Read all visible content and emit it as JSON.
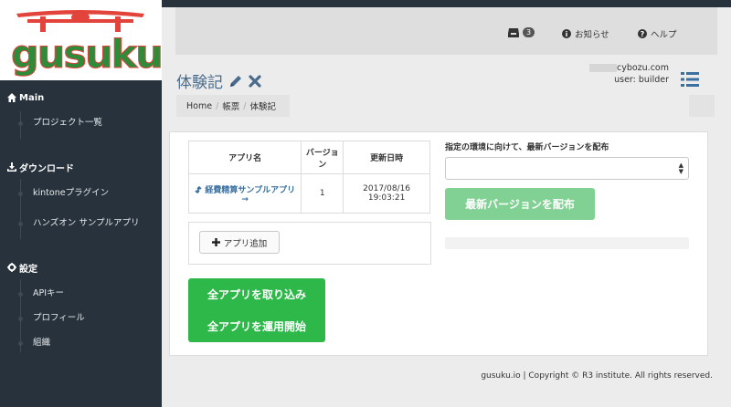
{
  "brand": {
    "logo_text": "gusuku",
    "logo_color": "#2e8b3a",
    "accent_red": "#e2443c"
  },
  "sidebar": {
    "sections": [
      {
        "header": "Main",
        "icon": "home-icon",
        "items": [
          "プロジェクト一覧"
        ]
      },
      {
        "header": "ダウンロード",
        "icon": "download-icon",
        "items": [
          "kintoneプラグイン",
          "ハンズオン サンプルアプリ"
        ]
      },
      {
        "header": "設定",
        "icon": "gear-icon",
        "items": [
          "APIキー",
          "プロフィール",
          "組織"
        ]
      }
    ]
  },
  "header": {
    "notifications_count": "3",
    "news_label": "お知らせ",
    "help_label": "ヘルプ"
  },
  "page": {
    "title": "体験記",
    "user_email": "cybozu.com",
    "user_line": "user: builder"
  },
  "breadcrumb": {
    "items": [
      "Home",
      "帳票",
      "体験記"
    ]
  },
  "apps_table": {
    "headers": [
      "アプリ名",
      "バージョン",
      "更新日時"
    ],
    "rows": [
      {
        "name": "経費精算サンプルアプリ →",
        "version": "1",
        "updated": "2017/08/16 19:03:21"
      }
    ]
  },
  "buttons": {
    "add_app": "アプリ追加",
    "import_all": "全アプリを取り込み",
    "start_all": "全アプリを運用開始",
    "deploy": "最新バージョンを配布"
  },
  "deploy": {
    "label": "指定の環境に向けて、最新バージョンを配布",
    "selected": ""
  },
  "footer": {
    "text": "gusuku.io | Copyright © R3 institute. All rights reserved."
  },
  "colors": {
    "sidebar_bg": "#27323c",
    "primary_green": "#2eb84a",
    "disabled_green": "#82d194",
    "title_blue": "#4a6c8c"
  }
}
